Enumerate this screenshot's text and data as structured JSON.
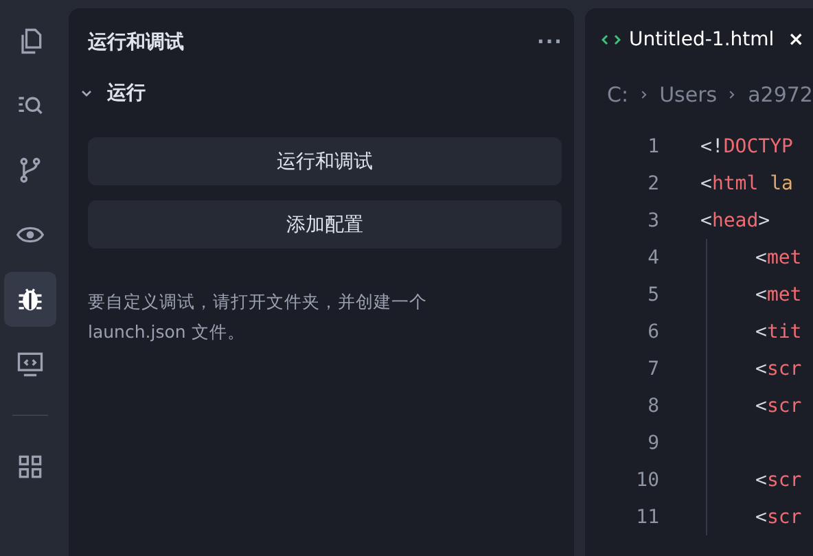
{
  "activity_bar": [
    {
      "kind": "files",
      "selected": false
    },
    {
      "kind": "search",
      "selected": false
    },
    {
      "kind": "branch",
      "selected": false
    },
    {
      "kind": "eye",
      "selected": false
    },
    {
      "kind": "bug",
      "selected": true
    },
    {
      "kind": "remote",
      "selected": false
    }
  ],
  "activity_bar_bottom": [
    {
      "kind": "extensions",
      "selected": false
    }
  ],
  "sidebar": {
    "title": "运行和调试",
    "more": "···",
    "section": {
      "label": "运行",
      "expanded": true
    },
    "buttons": [
      "运行和调试",
      "添加配置"
    ],
    "message": "要自定义调试，请打开文件夹，并创建一个 launch.json 文件。"
  },
  "editor": {
    "tab": {
      "label": "Untitled-1.html",
      "close": "×",
      "selected": true
    },
    "breadcrumb": [
      "C:",
      "Users",
      "a2972"
    ],
    "lines": [
      {
        "number": "1",
        "tokens": [
          {
            "kind": "punct",
            "text": "<!"
          },
          {
            "kind": "tag",
            "text": "DOCTYP"
          }
        ]
      },
      {
        "number": "2",
        "tokens": [
          {
            "kind": "punct",
            "text": "<"
          },
          {
            "kind": "tag",
            "text": "html"
          },
          {
            "kind": "attr",
            "text": " la"
          }
        ]
      },
      {
        "number": "3",
        "tokens": [
          {
            "kind": "punct",
            "text": "<"
          },
          {
            "kind": "tag",
            "text": "head"
          },
          {
            "kind": "punct",
            "text": ">"
          }
        ],
        "children": [
          {
            "number": "4",
            "tokens": [
              {
                "kind": "punct",
                "text": "<"
              },
              {
                "kind": "tag",
                "text": "met"
              }
            ]
          },
          {
            "number": "5",
            "tokens": [
              {
                "kind": "punct",
                "text": "<"
              },
              {
                "kind": "tag",
                "text": "met"
              }
            ]
          },
          {
            "number": "6",
            "tokens": [
              {
                "kind": "punct",
                "text": "<"
              },
              {
                "kind": "tag",
                "text": "tit"
              }
            ]
          },
          {
            "number": "7",
            "tokens": [
              {
                "kind": "punct",
                "text": "<"
              },
              {
                "kind": "tag",
                "text": "scr"
              }
            ]
          },
          {
            "number": "8",
            "tokens": [
              {
                "kind": "punct",
                "text": "<"
              },
              {
                "kind": "tag",
                "text": "scr"
              }
            ]
          },
          {
            "number": "9"
          },
          {
            "number": "10",
            "tokens": [
              {
                "kind": "punct",
                "text": "<"
              },
              {
                "kind": "tag",
                "text": "scr"
              }
            ]
          },
          {
            "number": "11",
            "tokens": [
              {
                "kind": "punct",
                "text": "<"
              },
              {
                "kind": "tag",
                "text": "scr"
              }
            ]
          }
        ]
      }
    ]
  }
}
